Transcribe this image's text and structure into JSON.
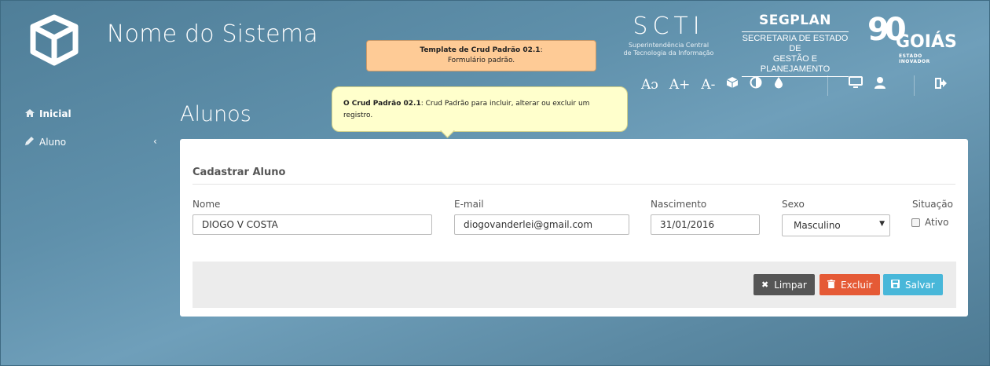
{
  "header": {
    "system_name": "Nome do Sistema",
    "scti": {
      "logo_text": "SCTI",
      "sub_line1": "Superintendência Central",
      "sub_line2": "de Tecnologia da Informação"
    },
    "segplan": {
      "title": "SEGPLAN",
      "sub_line1": "SECRETARIA DE ESTADO DE",
      "sub_line2": "GESTÃO E PLANEJAMENTO"
    },
    "goias": {
      "numeral": "90",
      "name": "GOIÁS",
      "tagline": "ESTADO INOVADOR"
    },
    "toolbar": {
      "font_reset": "Aɔ",
      "font_increase": "A+",
      "font_decrease": "A-"
    }
  },
  "tooltips": {
    "template": {
      "title": "Template de Crud Padrão 02.1",
      "title_suffix": ":",
      "body": "Formulário padrão."
    },
    "crud": {
      "title": "O Crud Padrão 02.1",
      "body": ": Crud Padrão para incluir, alterar ou excluir um registro."
    }
  },
  "sidebar": {
    "items": [
      {
        "label": "Inicial",
        "icon": "home-icon"
      },
      {
        "label": "Aluno",
        "icon": "pencil-icon",
        "chevron": "‹"
      }
    ]
  },
  "page": {
    "title": "Alunos"
  },
  "form": {
    "heading": "Cadastrar Aluno",
    "fields": {
      "nome": {
        "label": "Nome",
        "value": "DIOGO V COSTA"
      },
      "email": {
        "label": "E-mail",
        "value": "diogovanderlei@gmail.com"
      },
      "nascimento": {
        "label": "Nascimento",
        "value": "31/01/2016"
      },
      "sexo": {
        "label": "Sexo",
        "value": "Masculino"
      },
      "situacao": {
        "label": "Situação",
        "checkbox_label": "Ativo",
        "checked": false
      }
    },
    "actions": {
      "limpar": "Limpar",
      "excluir": "Excluir",
      "salvar": "Salvar"
    }
  },
  "colors": {
    "background": "#5f90ab",
    "tooltip_orange": "#fecb96",
    "tooltip_yellow": "#ffffcc",
    "btn_limpar": "#555555",
    "btn_excluir": "#e55a36",
    "btn_salvar": "#48b7d9"
  }
}
